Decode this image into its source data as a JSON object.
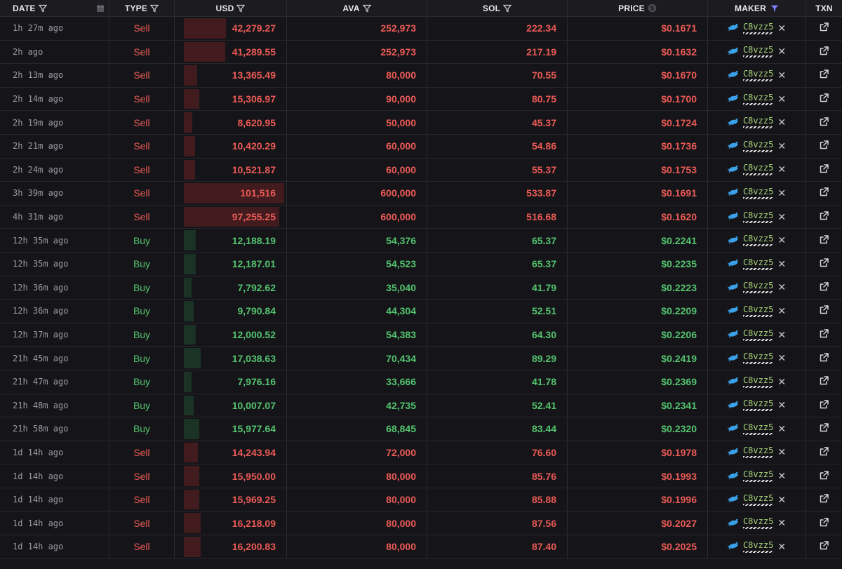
{
  "header": {
    "date": "DATE",
    "type": "TYPE",
    "usd": "USD",
    "ava": "AVA",
    "sol": "SOL",
    "price": "PRICE",
    "maker": "MAKER",
    "txn": "TXN"
  },
  "colors": {
    "sell": "#eb5a55",
    "buy": "#54c36e",
    "filter_active": "#7b7bff"
  },
  "rows": [
    {
      "date": "1h 27m ago",
      "type": "Sell",
      "usd": "42,279.27",
      "ava": "252,973",
      "sol": "222.34",
      "price": "$0.1671",
      "maker": "C8vzz5",
      "bar_pct": 0.38
    },
    {
      "date": "2h ago",
      "type": "Sell",
      "usd": "41,289.55",
      "ava": "252,973",
      "sol": "217.19",
      "price": "$0.1632",
      "maker": "C8vzz5",
      "bar_pct": 0.37
    },
    {
      "date": "2h 13m ago",
      "type": "Sell",
      "usd": "13,365.49",
      "ava": "80,000",
      "sol": "70.55",
      "price": "$0.1670",
      "maker": "C8vzz5",
      "bar_pct": 0.12
    },
    {
      "date": "2h 14m ago",
      "type": "Sell",
      "usd": "15,306.97",
      "ava": "90,000",
      "sol": "80.75",
      "price": "$0.1700",
      "maker": "C8vzz5",
      "bar_pct": 0.14
    },
    {
      "date": "2h 19m ago",
      "type": "Sell",
      "usd": "8,620.95",
      "ava": "50,000",
      "sol": "45.37",
      "price": "$0.1724",
      "maker": "C8vzz5",
      "bar_pct": 0.08
    },
    {
      "date": "2h 21m ago",
      "type": "Sell",
      "usd": "10,420.29",
      "ava": "60,000",
      "sol": "54.86",
      "price": "$0.1736",
      "maker": "C8vzz5",
      "bar_pct": 0.1
    },
    {
      "date": "2h 24m ago",
      "type": "Sell",
      "usd": "10,521.87",
      "ava": "60,000",
      "sol": "55.37",
      "price": "$0.1753",
      "maker": "C8vzz5",
      "bar_pct": 0.1
    },
    {
      "date": "3h 39m ago",
      "type": "Sell",
      "usd": "101,516",
      "ava": "600,000",
      "sol": "533.87",
      "price": "$0.1691",
      "maker": "C8vzz5",
      "bar_pct": 0.9
    },
    {
      "date": "4h 31m ago",
      "type": "Sell",
      "usd": "97,255.25",
      "ava": "600,000",
      "sol": "516.68",
      "price": "$0.1620",
      "maker": "C8vzz5",
      "bar_pct": 0.86
    },
    {
      "date": "12h 35m ago",
      "type": "Buy",
      "usd": "12,188.19",
      "ava": "54,376",
      "sol": "65.37",
      "price": "$0.2241",
      "maker": "C8vzz5",
      "bar_pct": 0.11
    },
    {
      "date": "12h 35m ago",
      "type": "Buy",
      "usd": "12,187.01",
      "ava": "54,523",
      "sol": "65.37",
      "price": "$0.2235",
      "maker": "C8vzz5",
      "bar_pct": 0.11
    },
    {
      "date": "12h 36m ago",
      "type": "Buy",
      "usd": "7,792.62",
      "ava": "35,040",
      "sol": "41.79",
      "price": "$0.2223",
      "maker": "C8vzz5",
      "bar_pct": 0.07
    },
    {
      "date": "12h 36m ago",
      "type": "Buy",
      "usd": "9,790.84",
      "ava": "44,304",
      "sol": "52.51",
      "price": "$0.2209",
      "maker": "C8vzz5",
      "bar_pct": 0.09
    },
    {
      "date": "12h 37m ago",
      "type": "Buy",
      "usd": "12,000.52",
      "ava": "54,383",
      "sol": "64.30",
      "price": "$0.2206",
      "maker": "C8vzz5",
      "bar_pct": 0.11
    },
    {
      "date": "21h 45m ago",
      "type": "Buy",
      "usd": "17,038.63",
      "ava": "70,434",
      "sol": "89.29",
      "price": "$0.2419",
      "maker": "C8vzz5",
      "bar_pct": 0.15
    },
    {
      "date": "21h 47m ago",
      "type": "Buy",
      "usd": "7,976.16",
      "ava": "33,666",
      "sol": "41.78",
      "price": "$0.2369",
      "maker": "C8vzz5",
      "bar_pct": 0.07
    },
    {
      "date": "21h 48m ago",
      "type": "Buy",
      "usd": "10,007.07",
      "ava": "42,735",
      "sol": "52.41",
      "price": "$0.2341",
      "maker": "C8vzz5",
      "bar_pct": 0.09
    },
    {
      "date": "21h 58m ago",
      "type": "Buy",
      "usd": "15,977.64",
      "ava": "68,845",
      "sol": "83.44",
      "price": "$0.2320",
      "maker": "C8vzz5",
      "bar_pct": 0.14
    },
    {
      "date": "1d 14h ago",
      "type": "Sell",
      "usd": "14,243.94",
      "ava": "72,000",
      "sol": "76.60",
      "price": "$0.1978",
      "maker": "C8vzz5",
      "bar_pct": 0.13
    },
    {
      "date": "1d 14h ago",
      "type": "Sell",
      "usd": "15,950.00",
      "ava": "80,000",
      "sol": "85.76",
      "price": "$0.1993",
      "maker": "C8vzz5",
      "bar_pct": 0.14
    },
    {
      "date": "1d 14h ago",
      "type": "Sell",
      "usd": "15,969.25",
      "ava": "80,000",
      "sol": "85.88",
      "price": "$0.1996",
      "maker": "C8vzz5",
      "bar_pct": 0.14
    },
    {
      "date": "1d 14h ago",
      "type": "Sell",
      "usd": "16,218.09",
      "ava": "80,000",
      "sol": "87.56",
      "price": "$0.2027",
      "maker": "C8vzz5",
      "bar_pct": 0.15
    },
    {
      "date": "1d 14h ago",
      "type": "Sell",
      "usd": "16,200.83",
      "ava": "80,000",
      "sol": "87.40",
      "price": "$0.2025",
      "maker": "C8vzz5",
      "bar_pct": 0.15
    }
  ]
}
